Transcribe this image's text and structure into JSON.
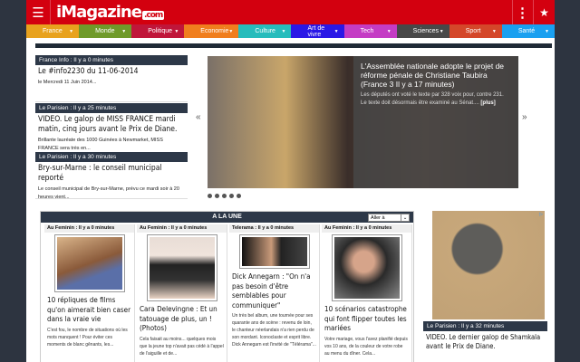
{
  "header": {
    "logo_text": "iMagazine",
    "logo_suffix": ".com",
    "menu_icon": "hamburger-icon",
    "more_icon": "kebab-icon",
    "star_icon": "star-add-icon"
  },
  "nav": [
    {
      "label": "France",
      "color": "#e8a21e"
    },
    {
      "label": "Monde",
      "color": "#6f9a2a"
    },
    {
      "label": "Politique",
      "color": "#c0163a"
    },
    {
      "label": "Economie",
      "color": "#f07e1e"
    },
    {
      "label": "Culture",
      "color": "#27bcbc"
    },
    {
      "label": "Art de vivre",
      "color": "#2a18e6"
    },
    {
      "label": "Tech",
      "color": "#c43cc4"
    },
    {
      "label": "Sciences",
      "color": "#484848"
    },
    {
      "label": "Sport",
      "color": "#d4472a"
    },
    {
      "label": "Santé",
      "color": "#1aa0f0"
    }
  ],
  "side": [
    {
      "source": "France Info : Il y a 0 minutes",
      "title": "Le #info2230 du 11-06-2014",
      "desc": "le Mercredi 11 Juin 2014..."
    },
    {
      "source": "Le Parisien : Il y a 25 minutes",
      "title": "VIDEO. Le galop de MISS FRANCE mardi matin, cinq jours avant le Prix de Diane.",
      "desc": "Brillante lauréate des 1000 Guinées à Newmarket, MISS FRANCE sera très en..."
    },
    {
      "source": "Le Parisien : Il y a 30 minutes",
      "title": "Bry-sur-Marne : le conseil municipal reporté",
      "desc": "Le conseil municipal de Bry-sur-Marne, prévu ce mardi soir à 20 heures vient..."
    }
  ],
  "slider": {
    "title": "L'Assemblée nationale adopte le projet de réforme pénale de Christiane Taubira (France 3 Il y a 17 minutes)",
    "desc": "Les députés ont voté le texte par 328 voix pour, contre 231. Le texte doit désormais être examiné au Sénat....",
    "more": "[plus]",
    "prev": "«",
    "next": "»",
    "dots": 5
  },
  "une": {
    "title": "A LA UNE",
    "select": "Aller à",
    "items": [
      {
        "source": "Au Feminin : Il y a 0 minutes",
        "title": "10 répliques de films qu'on aimerait bien caser dans la vraie vie",
        "desc": "C'est fou, le nombre de situations où les mots manquent ! Pour éviter ces moments de blanc gênants, les..."
      },
      {
        "source": "Au Feminin : Il y a 0 minutes",
        "title": "Cara Delevingne : Et un tatouage de plus, un ! (Photos)",
        "desc": "Cela faisait au moins... quelques mois que la jeune top n'avait pas cédé à l'appel de l'aiguille et de..."
      },
      {
        "source": "Telerama : Il y a 0 minutes",
        "title": "Dick Annegarn : \"On n'a pas besoin d'être semblables pour communiquer\"",
        "desc": "Un très bel album, une tournée pour ses quarante ans de scène : revenu de loin, le chanteur néerlandais n'a rien perdu de son mordant. Iconoclaste et esprit libre. Dick Annegarn est l'invité de \"Télérama\"..."
      },
      {
        "source": "Au Feminin : Il y a 0 minutes",
        "title": "10 scénarios catastrophe qui font flipper toutes les mariées",
        "desc": "Votre mariage, vous l'avez planifié depuis vos 10 ans, de la couleur de votre robe au menu du dîner. Cela..."
      }
    ]
  },
  "ad": {
    "badge": "▷",
    "source": "Le Parisien : Il y a 32 minutes",
    "title": "VIDEO. Le dernier galop de Shamkala avant le Prix de Diane."
  }
}
